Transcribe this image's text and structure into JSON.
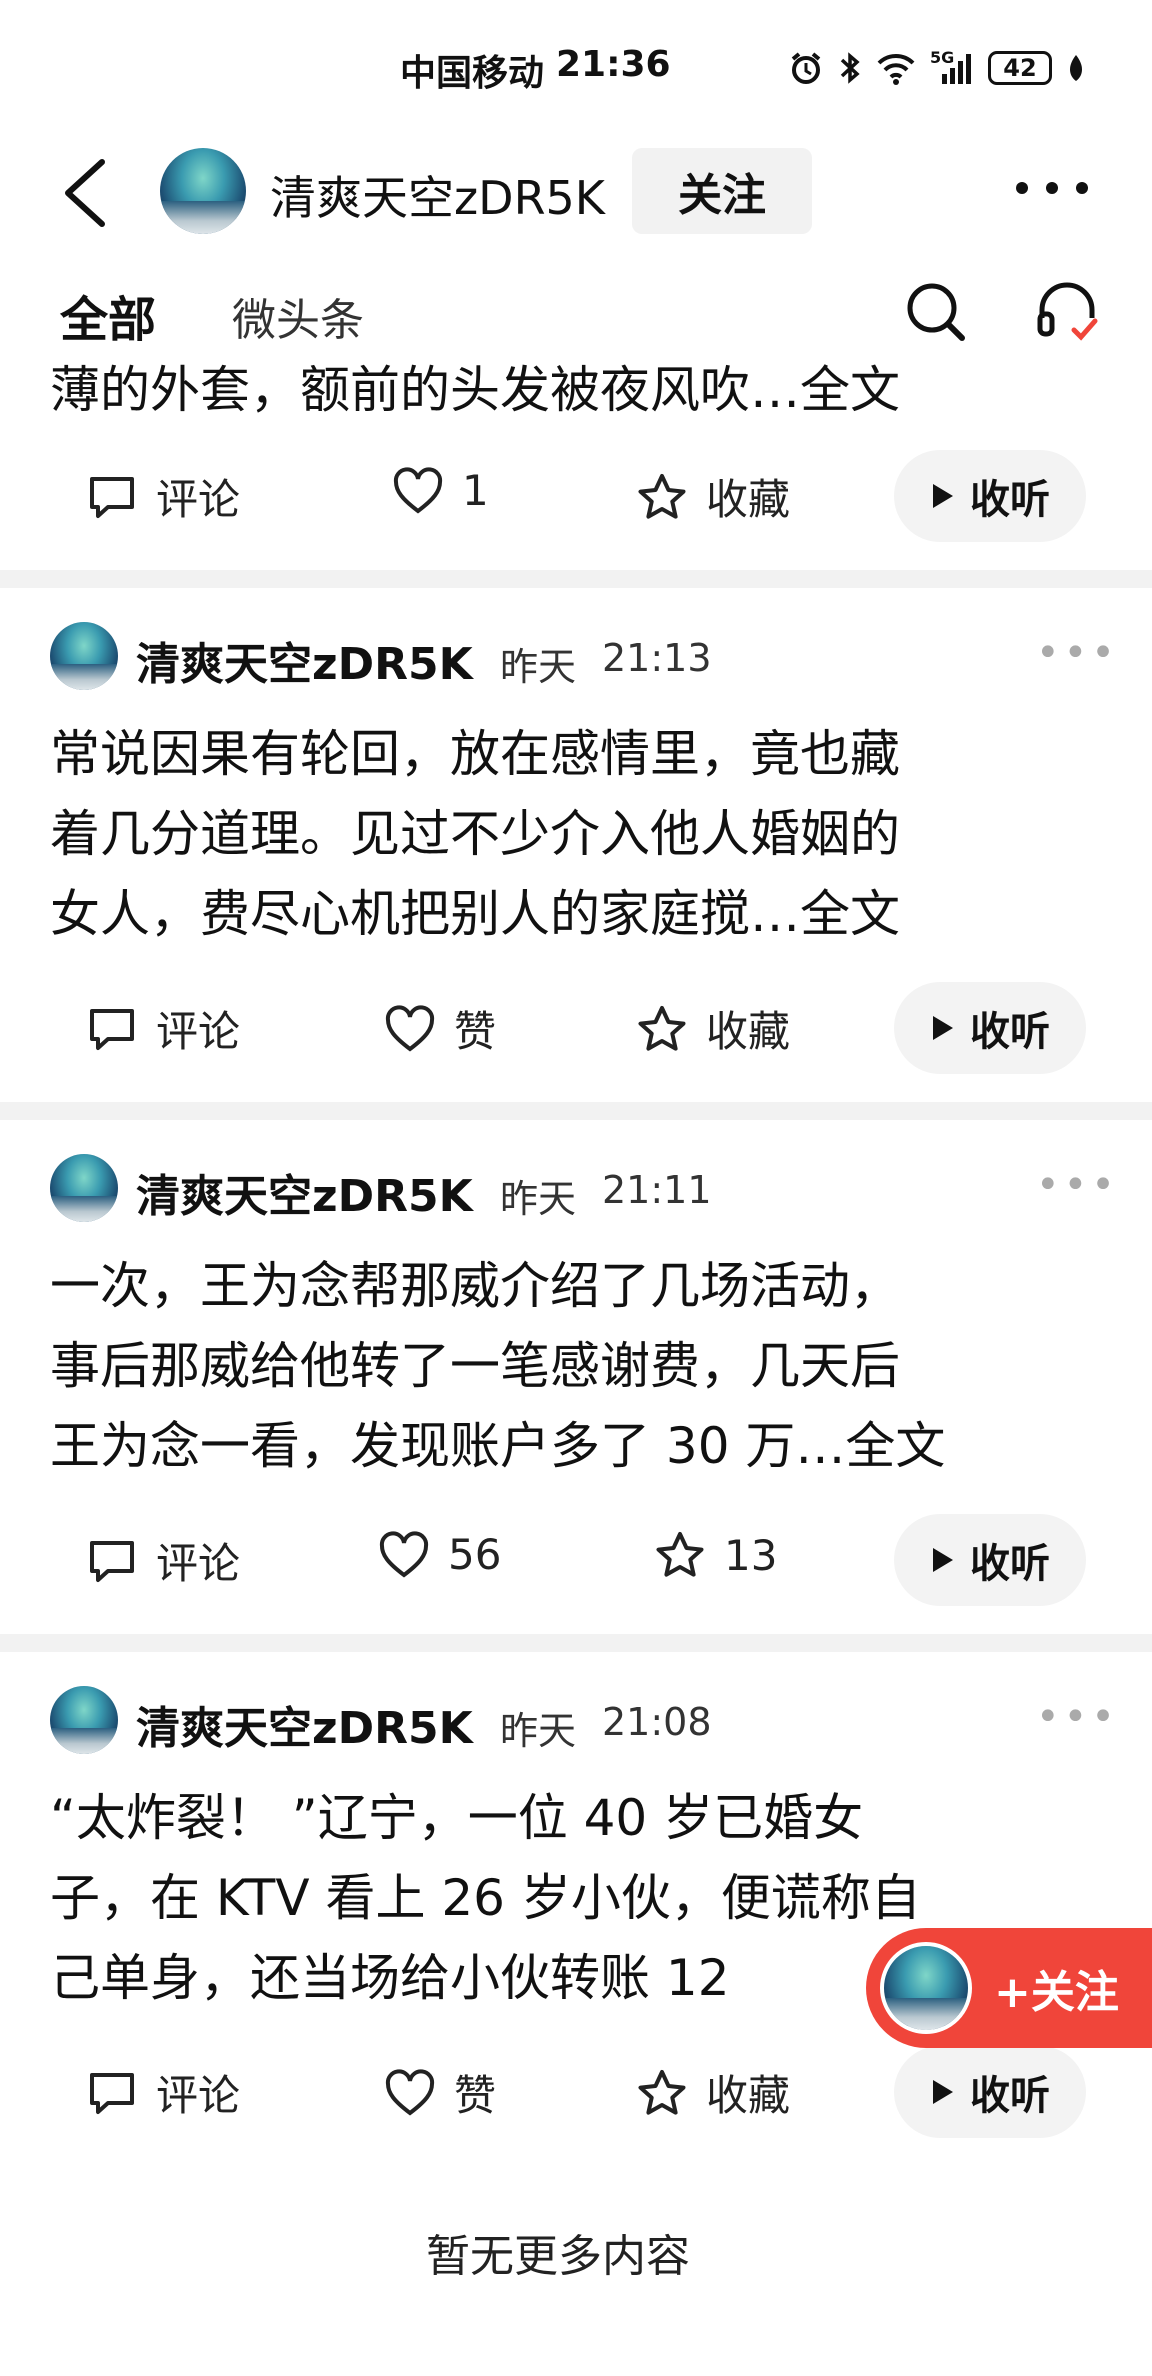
{
  "status_bar": {
    "carrier": "中国移动",
    "time": "21:36",
    "network": "5G",
    "battery": "42"
  },
  "header": {
    "account_name": "清爽天空zDR5K",
    "follow_label": "关注"
  },
  "tabs": {
    "all": "全部",
    "micro": "微头条"
  },
  "partial_post": {
    "text_line": "薄的外套，额前的头发被夜风吹…全文",
    "comment_label": "评论",
    "like_label": "1",
    "fav_label": "收藏",
    "listen_label": "收听"
  },
  "posts": [
    {
      "author": "清爽天空zDR5K",
      "date": "昨天",
      "time": "21:13",
      "lines": [
        "常说因果有轮回，放在感情里，竟也藏",
        "着几分道理。见过不少介入他人婚姻的",
        "女人，费尽心机把别人的家庭搅…全文"
      ],
      "comment_label": "评论",
      "like_label": "赞",
      "fav_label": "收藏",
      "listen_label": "收听"
    },
    {
      "author": "清爽天空zDR5K",
      "date": "昨天",
      "time": "21:11",
      "lines": [
        "一次，王为念帮那威介绍了几场活动，",
        "事后那威给他转了一笔感谢费，几天后",
        "王为念一看，发现账户多了 30 万…全文"
      ],
      "comment_label": "评论",
      "like_label": "56",
      "fav_label": "13",
      "listen_label": "收听"
    },
    {
      "author": "清爽天空zDR5K",
      "date": "昨天",
      "time": "21:08",
      "lines": [
        "“太炸裂！ ”辽宁，一位 40 岁已婚女",
        "子，在 KTV 看上 26 岁小伙，便谎称自",
        "己单身，还当场给小伙转账 12"
      ],
      "comment_label": "评论",
      "like_label": "赞",
      "fav_label": "收藏",
      "listen_label": "收听"
    }
  ],
  "floating_follow": {
    "label": "+关注"
  },
  "footer": {
    "end_text": "暂无更多内容"
  },
  "colors": {
    "accent": "#f0453a",
    "background": "#ffffff",
    "divider": "#f2f2f2"
  }
}
